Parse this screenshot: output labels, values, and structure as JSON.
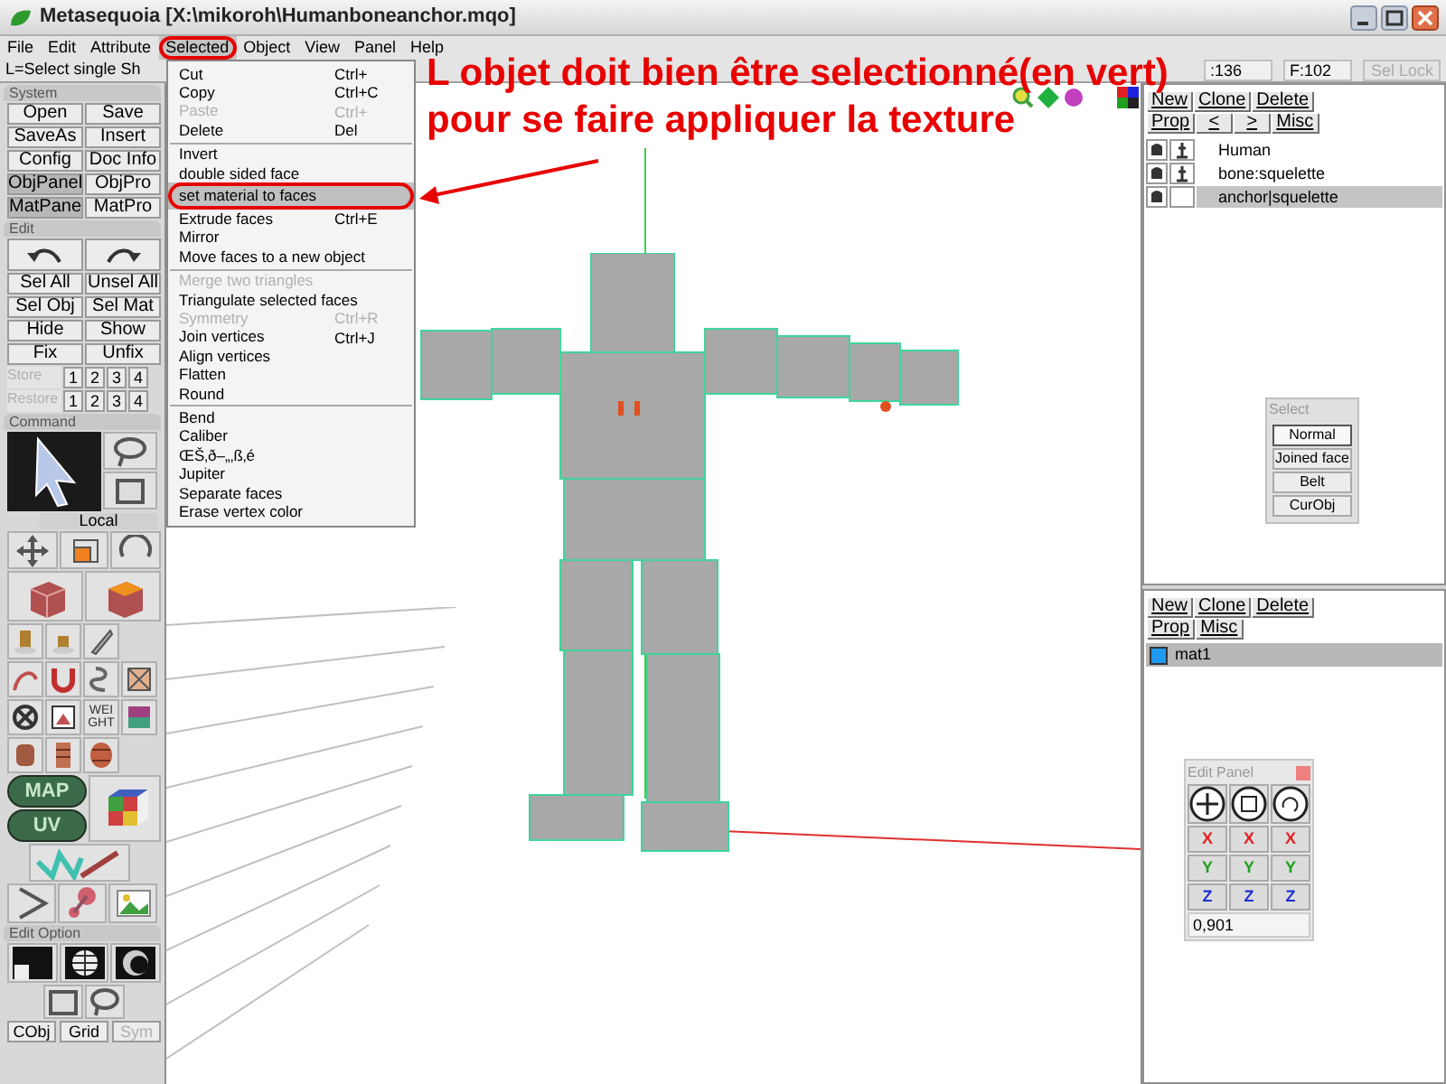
{
  "window": {
    "title": "Metasequoia [X:\\mikoroh\\Humanboneanchor.mqo]"
  },
  "menu": [
    {
      "label": "File",
      "selected": false
    },
    {
      "label": "Edit",
      "selected": false
    },
    {
      "label": "Attribute",
      "selected": false
    },
    {
      "label": "Selected",
      "selected": true
    },
    {
      "label": "Object",
      "selected": false
    },
    {
      "label": "View",
      "selected": false
    },
    {
      "label": "Panel",
      "selected": false
    },
    {
      "label": "Help",
      "selected": false
    }
  ],
  "status": {
    "hint": "L=Select single  Sh",
    "readouts": [
      ":136",
      "F:102"
    ],
    "sel_lock": {
      "label": "Sel Lock",
      "disabled": true
    }
  },
  "system": {
    "title": "System",
    "rows": [
      [
        "Open",
        "Save"
      ],
      [
        "SaveAs",
        "Insert"
      ],
      [
        "Config",
        "Doc Info"
      ]
    ],
    "toggles": [
      {
        "label": "ObjPanel",
        "pressed": true
      },
      {
        "label": "ObjPro",
        "pressed": false
      },
      {
        "label": "MatPane",
        "pressed": true
      },
      {
        "label": "MatPro",
        "pressed": false
      }
    ]
  },
  "edit": {
    "title": "Edit",
    "rows": [
      [
        "Sel All",
        "Unsel All"
      ],
      [
        "Sel Obj",
        "Sel Mat"
      ],
      [
        "Hide",
        "Show"
      ],
      [
        "Fix",
        "Unfix"
      ]
    ],
    "memory": [
      {
        "label": "Store",
        "disabled": true,
        "slots": [
          "1",
          "2",
          "3",
          "4"
        ]
      },
      {
        "label": "Restore",
        "disabled": true,
        "slots": [
          "1",
          "2",
          "3",
          "4"
        ]
      }
    ]
  },
  "command": {
    "title": "Command",
    "local_label": "Local",
    "weight_lines": [
      "WEI",
      "GHT"
    ],
    "map_label": "MAP",
    "uv_label": "UV"
  },
  "edit_option": {
    "title": "Edit Option",
    "buttons": [
      {
        "label": "CObj",
        "disabled": false
      },
      {
        "label": "Grid",
        "disabled": false
      },
      {
        "label": "Sym",
        "disabled": true
      }
    ]
  },
  "dropdown": [
    {
      "kind": "item",
      "label": "Cut",
      "shortcut": "Ctrl+",
      "disabled": false,
      "selected": false
    },
    {
      "kind": "item",
      "label": "Copy",
      "shortcut": "Ctrl+C",
      "disabled": false,
      "selected": false
    },
    {
      "kind": "item",
      "label": "Paste",
      "shortcut": "Ctrl+",
      "disabled": true,
      "selected": false
    },
    {
      "kind": "item",
      "label": "Delete",
      "shortcut": "Del",
      "disabled": false,
      "selected": false
    },
    {
      "kind": "separator"
    },
    {
      "kind": "item",
      "label": "Invert",
      "disabled": false,
      "selected": false
    },
    {
      "kind": "item",
      "label": "double sided face",
      "disabled": false,
      "selected": false
    },
    {
      "kind": "item",
      "label": "set material to faces",
      "disabled": false,
      "selected": true
    },
    {
      "kind": "item",
      "label": "Extrude faces",
      "shortcut": "Ctrl+E",
      "disabled": false,
      "selected": false
    },
    {
      "kind": "item",
      "label": "Mirror",
      "disabled": false,
      "selected": false
    },
    {
      "kind": "item",
      "label": "Move faces to a new object",
      "disabled": false,
      "selected": false
    },
    {
      "kind": "separator"
    },
    {
      "kind": "item",
      "label": "Merge two triangles",
      "disabled": true,
      "selected": false
    },
    {
      "kind": "item",
      "label": "Triangulate selected faces",
      "disabled": false,
      "selected": false
    },
    {
      "kind": "item",
      "label": "Symmetry",
      "shortcut": "Ctrl+R",
      "disabled": true,
      "selected": false
    },
    {
      "kind": "item",
      "label": "Join vertices",
      "shortcut": "Ctrl+J",
      "disabled": false,
      "selected": false
    },
    {
      "kind": "item",
      "label": "Align vertices",
      "disabled": false,
      "selected": false
    },
    {
      "kind": "item",
      "label": "Flatten",
      "disabled": false,
      "selected": false
    },
    {
      "kind": "item",
      "label": "Round",
      "disabled": false,
      "selected": false
    },
    {
      "kind": "separator"
    },
    {
      "kind": "item",
      "label": "Bend",
      "disabled": false,
      "selected": false
    },
    {
      "kind": "item",
      "label": "Caliber",
      "disabled": false,
      "selected": false
    },
    {
      "kind": "item",
      "label": "ŒŠ‚ð–„‚ß‚é",
      "disabled": false,
      "selected": false
    },
    {
      "kind": "item",
      "label": "Jupiter",
      "disabled": false,
      "selected": false
    },
    {
      "kind": "item",
      "label": "Separate faces",
      "disabled": false,
      "selected": false
    },
    {
      "kind": "item",
      "label": "Erase vertex color",
      "disabled": false,
      "selected": false
    }
  ],
  "annotation": {
    "lines": [
      "L objet doit bien être selectionné(en vert)",
      "pour se faire appliquer la texture"
    ]
  },
  "objects": {
    "buttons": [
      [
        "New",
        "Clone",
        "Delete"
      ],
      [
        "Prop",
        "<",
        ">",
        "Misc"
      ]
    ],
    "items": [
      {
        "name": "Human",
        "visible": true,
        "locked": true,
        "selected": false
      },
      {
        "name": "bone:squelette",
        "visible": true,
        "locked": true,
        "selected": false
      },
      {
        "name": "anchor|squelette",
        "visible": true,
        "locked": false,
        "selected": true
      }
    ]
  },
  "select_panel": {
    "title": "Select",
    "options": [
      {
        "label": "Normal",
        "selected": true
      },
      {
        "label": "Joined face",
        "selected": false
      },
      {
        "label": "Belt",
        "selected": false
      },
      {
        "label": "CurObj",
        "selected": false
      }
    ]
  },
  "materials": {
    "buttons": [
      [
        "New",
        "Clone",
        "Delete"
      ],
      [
        "Prop",
        "Misc"
      ]
    ],
    "items": [
      {
        "name": "mat1",
        "color": "#1e9bf0",
        "selected": true
      }
    ]
  },
  "edit_panel": {
    "title": "Edit Panel",
    "axes": [
      {
        "color": "#e02020",
        "buttons": [
          "X",
          "X",
          "X"
        ]
      },
      {
        "color": "#20a020",
        "buttons": [
          "Y",
          "Y",
          "Y"
        ]
      },
      {
        "color": "#2030d0",
        "buttons": [
          "Z",
          "Z",
          "Z"
        ]
      }
    ],
    "value": "0,901"
  }
}
